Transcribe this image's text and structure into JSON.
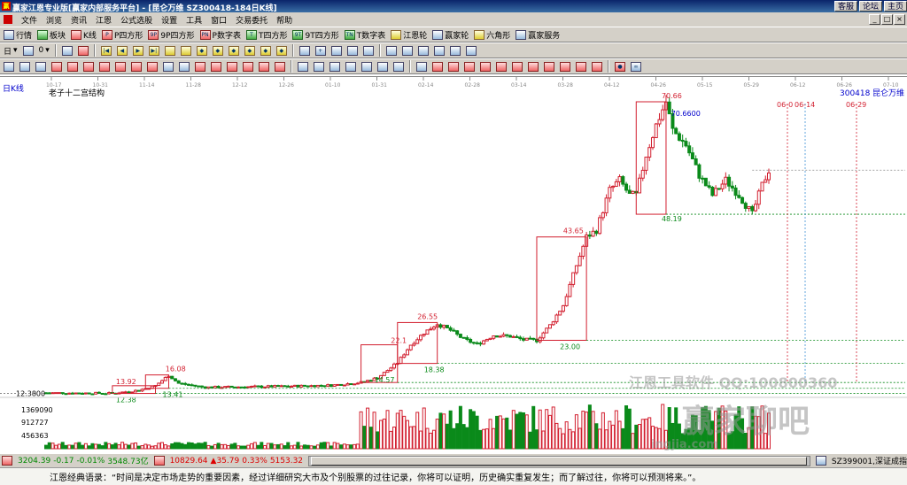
{
  "window": {
    "title": "赢家江恩专业版[赢家内部服务平台] - [昆仑万维  SZ300418-184日K线]",
    "links": [
      "客服",
      "论坛",
      "主页"
    ],
    "controls": [
      "_",
      "□",
      "×"
    ]
  },
  "menu": [
    "文件",
    "浏览",
    "资讯",
    "江恩",
    "公式选股",
    "设置",
    "工具",
    "窗口",
    "交易委托",
    "帮助"
  ],
  "toolbar1": [
    {
      "icon": "table-icon",
      "label": "行情"
    },
    {
      "icon": "grid-icon",
      "label": "板块"
    },
    {
      "icon": "candle-icon",
      "label": "K线"
    },
    {
      "icon": "p-square-icon",
      "label": "P四方形"
    },
    {
      "icon": "9p-square-icon",
      "label": "9P四方形"
    },
    {
      "icon": "pn-icon",
      "label": "P数字表"
    },
    {
      "icon": "t-square-icon",
      "label": "T四方形"
    },
    {
      "icon": "9t-square-icon",
      "label": "9T四方形"
    },
    {
      "icon": "tn-icon",
      "label": "T数字表"
    },
    {
      "icon": "gann-wheel-icon",
      "label": "江恩轮"
    },
    {
      "icon": "winner-wheel-icon",
      "label": "赢家轮"
    },
    {
      "icon": "hexagon-icon",
      "label": "六角形"
    },
    {
      "icon": "service-icon",
      "label": "赢家服务"
    }
  ],
  "toolbar2": {
    "period": "日",
    "adjust": "0"
  },
  "chart": {
    "period_label": "日K线",
    "study_title": "老子十二宫结构",
    "stock_code": "300418",
    "stock_name": "昆仑万维",
    "date_axis": [
      "10-17",
      "10-31",
      "11-14",
      "11-28",
      "12-12",
      "12-26",
      "01-10",
      "01-31",
      "02-14",
      "02-28",
      "03-14",
      "03-28",
      "04-12",
      "04-26",
      "05-15",
      "05-29",
      "06-12",
      "06-26",
      "07-10"
    ],
    "future_dates": [
      "06-0",
      "06-14",
      "06-29"
    ],
    "price_labels": [
      "70.66",
      "70.6600",
      "48.19",
      "43.65",
      "23.00",
      "26.55",
      "22.1",
      "18.38",
      "14.57",
      "16.08",
      "13.92",
      "12.38",
      "13.41",
      "12.3800"
    ],
    "y_axis_left": "12.3800",
    "volume_labels": [
      "1369090",
      "912727",
      "456363"
    ],
    "colors": {
      "up": "#d21f2f",
      "down": "#0a8a1a",
      "box": "#d21f2f",
      "guide_green": "#0a8a1a",
      "guide_blue": "#3b8fd6"
    }
  },
  "chart_data": {
    "type": "candlestick",
    "title": "老子十二宫结构",
    "symbol": "300418 昆仑万维",
    "period": "daily",
    "key_levels": {
      "high": 70.66,
      "high_marker": 70.66,
      "low_after_high": 48.19,
      "box_top_4": 43.65,
      "box_bottom_4": 23.0,
      "peak_3": 26.55,
      "level_3": 22.1,
      "support_3": 18.38,
      "base_low": 14.57,
      "peak_1": 16.08,
      "level_1": 13.92,
      "low_1": 12.38,
      "support_1": 13.41,
      "start_price": 12.38
    },
    "volume_axis": [
      456363,
      912727,
      1369090
    ],
    "xaxis_ticks": [
      "10-17",
      "10-31",
      "11-14",
      "11-28",
      "12-12",
      "12-26",
      "01-10",
      "01-31",
      "02-14",
      "02-28",
      "03-14",
      "03-28",
      "04-12",
      "04-26",
      "05-15",
      "05-29",
      "06-12",
      "06-26",
      "07-10"
    ],
    "projected_dates": [
      "06-0",
      "06-14",
      "06-29"
    ]
  },
  "watermarks": [
    "江恩工具软件  QQ:100800360",
    "赢家聊吧",
    "ingjia.com"
  ],
  "status": {
    "sh_index": "3204.39",
    "sh_change": "-0.17",
    "sh_pct": "-0.01%",
    "sh_amount": "3548.73亿",
    "sz_index": "10829.64",
    "sz_change": "▲35.79",
    "sz_pct": "0.33%",
    "sz_amount": "5153.32",
    "current_index": "SZ399001,深证成指"
  },
  "quote": "江恩经典语录：“时间是决定市场走势的重要因素，经过详细研究大市及个别股票的过往记录，你将可以证明，历史确实重复发生；而了解过往，你将可以预测将来。”。"
}
